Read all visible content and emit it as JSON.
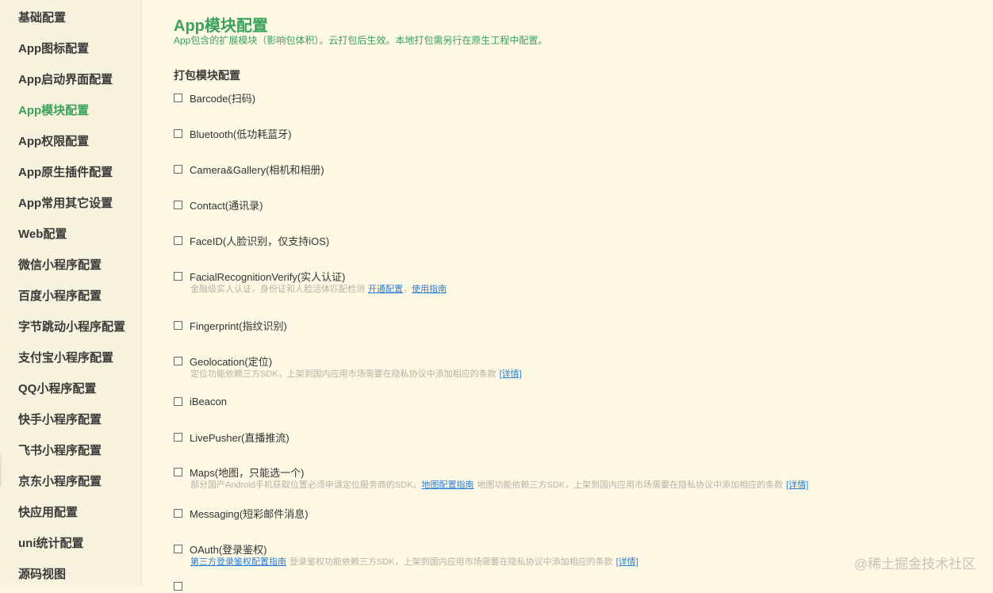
{
  "sidebar": {
    "items": [
      {
        "label": "基础配置",
        "active": false
      },
      {
        "label": "App图标配置",
        "active": false
      },
      {
        "label": "App启动界面配置",
        "active": false
      },
      {
        "label": "App模块配置",
        "active": true
      },
      {
        "label": "App权限配置",
        "active": false
      },
      {
        "label": "App原生插件配置",
        "active": false
      },
      {
        "label": "App常用其它设置",
        "active": false
      },
      {
        "label": "Web配置",
        "active": false
      },
      {
        "label": "微信小程序配置",
        "active": false
      },
      {
        "label": "百度小程序配置",
        "active": false
      },
      {
        "label": "字节跳动小程序配置",
        "active": false
      },
      {
        "label": "支付宝小程序配置",
        "active": false
      },
      {
        "label": "QQ小程序配置",
        "active": false
      },
      {
        "label": "快手小程序配置",
        "active": false
      },
      {
        "label": "飞书小程序配置",
        "active": false
      },
      {
        "label": "京东小程序配置",
        "active": false
      },
      {
        "label": "快应用配置",
        "active": false
      },
      {
        "label": "uni统计配置",
        "active": false
      },
      {
        "label": "源码视图",
        "active": false
      }
    ]
  },
  "main": {
    "title": "App模块配置",
    "subtitle": "App包含的扩展模块（影响包体积）。云打包后生效。本地打包需另行在原生工程中配置。",
    "section_title": "打包模块配置",
    "modules": [
      {
        "label": "Barcode(扫码)",
        "checked": false
      },
      {
        "label": "Bluetooth(低功耗蓝牙)",
        "checked": false
      },
      {
        "label": "Camera&Gallery(相机和相册)",
        "checked": false
      },
      {
        "label": "Contact(通讯录)",
        "checked": false
      },
      {
        "label": "FaceID(人脸识别，仅支持iOS)",
        "checked": false
      },
      {
        "label": "FacialRecognitionVerify(实人认证)",
        "checked": false,
        "note": {
          "text": "金融级实人认证，身份证和人脸活体匹配检测",
          "link1": "开通配置",
          "sep": "，",
          "link2": "使用指南"
        }
      },
      {
        "label": "Fingerprint(指纹识别)",
        "checked": false
      },
      {
        "label": "Geolocation(定位)",
        "checked": false,
        "note": {
          "text": "定位功能依赖三方SDK，上架到国内应用市场需要在隐私协议中添加相应的条款",
          "link1": "[详情]"
        }
      },
      {
        "label": "iBeacon",
        "checked": false
      },
      {
        "label": "LivePusher(直播推流)",
        "checked": false
      },
      {
        "label": "Maps(地图，只能选一个)",
        "checked": false,
        "note": {
          "text": "部分国产Android手机获取位置必须申请定位服务商的SDK。",
          "link1": "地图配置指南",
          "text2": "地图功能依赖三方SDK，上架到国内应用市场需要在隐私协议中添加相应的条款",
          "link2": "[详情]"
        }
      },
      {
        "label": "Messaging(短彩邮件消息)",
        "checked": false
      },
      {
        "label": "OAuth(登录鉴权)",
        "checked": false,
        "note": {
          "link1": "第三方登录鉴权配置指南",
          "text2": "登录鉴权功能依赖三方SDK，上架到国内应用市场需要在隐私协议中添加相应的条款",
          "link2": "[详情]"
        }
      }
    ]
  },
  "watermark": "@稀土掘金技术社区",
  "colors": {
    "background": "#fdf8e4",
    "accent": "#3aa15a",
    "link": "#2b7fd4",
    "muted": "#b7b2a0"
  }
}
